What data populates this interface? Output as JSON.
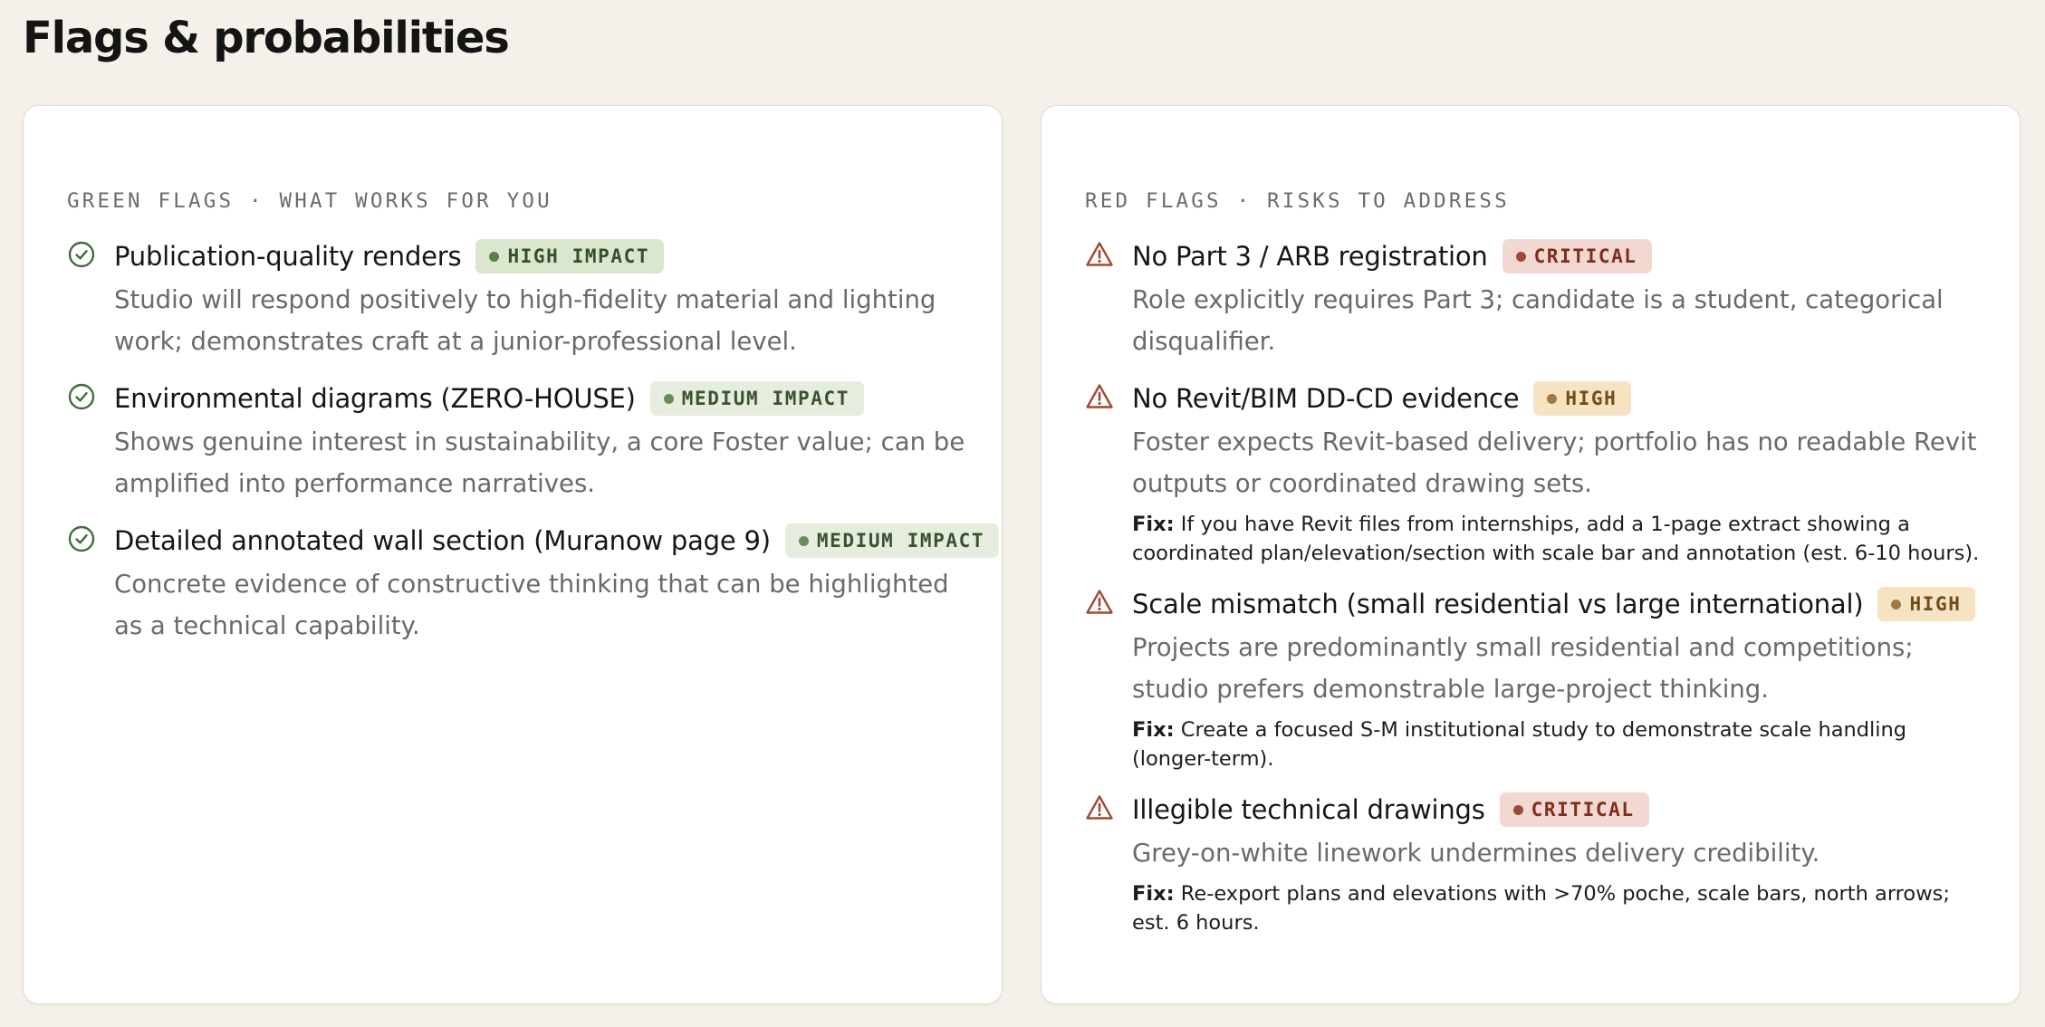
{
  "page": {
    "title": "Flags & probabilities"
  },
  "colors": {
    "green_accent": "#3f6e3a",
    "red_accent": "#a04a31",
    "page_bg": "#f5f0ea",
    "card_bg": "#ffffff"
  },
  "green_flags": {
    "label": "GREEN FLAGS · WHAT WORKS FOR YOU",
    "icon": "check-circle-icon",
    "items": [
      {
        "title": "Publication-quality renders",
        "badge": "HIGH IMPACT",
        "desc": "Studio will respond positively to high-fidelity material and lighting work; demonstrates craft at a junior-professional level."
      },
      {
        "title": "Environmental diagrams (ZERO-HOUSE)",
        "badge": "MEDIUM IMPACT",
        "desc": "Shows genuine interest in sustainability, a core Foster value; can be amplified into performance narratives."
      },
      {
        "title": "Detailed annotated wall section (Muranow page 9)",
        "badge": "MEDIUM IMPACT",
        "desc": "Concrete evidence of constructive thinking that can be highlighted as a technical capability."
      }
    ]
  },
  "red_flags": {
    "label": "RED FLAGS · RISKS TO ADDRESS",
    "icon": "warning-triangle-icon",
    "fix_label": "Fix:",
    "items": [
      {
        "title": "No Part 3 / ARB registration",
        "badge": "CRITICAL",
        "desc": "Role explicitly requires Part 3; candidate is a student, categorical disqualifier.",
        "fix": ""
      },
      {
        "title": "No Revit/BIM DD-CD evidence",
        "badge": "HIGH",
        "desc": "Foster expects Revit-based delivery; portfolio has no readable Revit outputs or coordinated drawing sets.",
        "fix": "If you have Revit files from internships, add a 1-page extract showing a coordinated plan/elevation/section with scale bar and annotation (est. 6-10 hours)."
      },
      {
        "title": "Scale mismatch (small residential vs large international)",
        "badge": "HIGH",
        "desc": "Projects are predominantly small residential and competitions; studio prefers demonstrable large-project thinking.",
        "fix": "Create a focused S-M institutional study to demonstrate scale handling (longer-term)."
      },
      {
        "title": "Illegible technical drawings",
        "badge": "CRITICAL",
        "desc": "Grey-on-white linework undermines delivery credibility.",
        "fix": "Re-export plans and elevations with >70% poche, scale bars, north arrows; est. 6 hours."
      }
    ]
  }
}
